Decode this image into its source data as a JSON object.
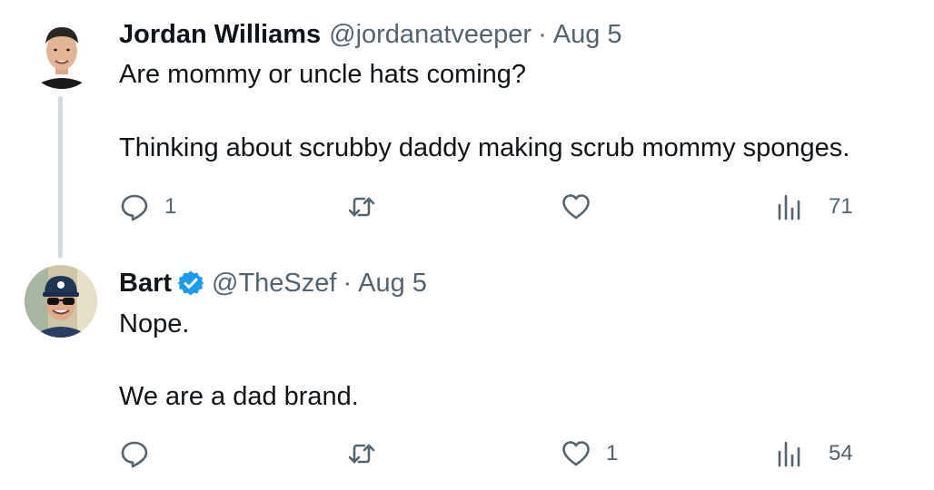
{
  "tweets": [
    {
      "author": {
        "display_name": "Jordan Williams",
        "handle": "@jordanatveeper",
        "verified": false
      },
      "date": "Aug 5",
      "separator": "·",
      "text": {
        "line1": "Are mommy or uncle hats coming?",
        "line2": "Thinking about scrubby daddy making scrub mommy sponges."
      },
      "actions": {
        "replies": "1",
        "retweets": "",
        "likes": "",
        "views": "71"
      }
    },
    {
      "author": {
        "display_name": "Bart",
        "handle": "@TheSzef",
        "verified": true
      },
      "date": "Aug 5",
      "separator": "·",
      "text": {
        "line1": "Nope.",
        "line2": "We are a dad brand."
      },
      "actions": {
        "replies": "",
        "retweets": "",
        "likes": "1",
        "views": "54"
      }
    }
  ],
  "colors": {
    "text_primary": "#0f1419",
    "text_secondary": "#536471",
    "thread_line": "#cfd9de",
    "verified_badge": "#1d9bf0"
  },
  "icons": [
    "reply-icon",
    "retweet-icon",
    "like-icon",
    "views-icon",
    "verified-badge-icon"
  ]
}
